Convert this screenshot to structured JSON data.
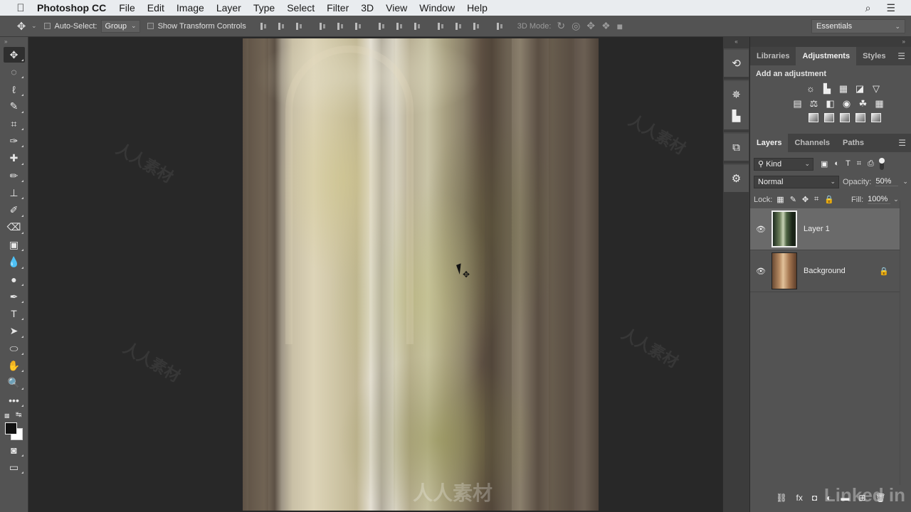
{
  "menubar": {
    "apple_icon": "",
    "app_name": "Photoshop CC",
    "items": [
      "File",
      "Edit",
      "Image",
      "Layer",
      "Type",
      "Select",
      "Filter",
      "3D",
      "View",
      "Window",
      "Help"
    ],
    "search_icon": "⌕",
    "list_icon": "☰"
  },
  "options_bar": {
    "tool_icon": "✥",
    "auto_select_label": "Auto-Select:",
    "auto_select_checked": false,
    "auto_select_target": "Group",
    "show_transform_label": "Show Transform Controls",
    "show_transform_checked": false,
    "mode_3d_label": "3D Mode:",
    "workspace": "Essentials"
  },
  "toolbar": {
    "tools": [
      {
        "name": "move-tool",
        "glyph": "✥",
        "active": true
      },
      {
        "name": "marquee-tool",
        "glyph": "◌"
      },
      {
        "name": "lasso-tool",
        "glyph": "ℓ"
      },
      {
        "name": "quick-selection-tool",
        "glyph": "✎"
      },
      {
        "name": "crop-tool",
        "glyph": "⌗"
      },
      {
        "name": "eyedropper-tool",
        "glyph": "✑"
      },
      {
        "name": "healing-brush-tool",
        "glyph": "✚"
      },
      {
        "name": "brush-tool",
        "glyph": "✏"
      },
      {
        "name": "clone-stamp-tool",
        "glyph": "⊥"
      },
      {
        "name": "history-brush-tool",
        "glyph": "✐"
      },
      {
        "name": "eraser-tool",
        "glyph": "⌫"
      },
      {
        "name": "gradient-tool",
        "glyph": "▣"
      },
      {
        "name": "blur-tool",
        "glyph": "💧"
      },
      {
        "name": "dodge-tool",
        "glyph": "●"
      },
      {
        "name": "pen-tool",
        "glyph": "✒"
      },
      {
        "name": "type-tool",
        "glyph": "T"
      },
      {
        "name": "path-selection-tool",
        "glyph": "➤"
      },
      {
        "name": "ellipse-tool",
        "glyph": "⬭"
      },
      {
        "name": "hand-tool",
        "glyph": "✋"
      },
      {
        "name": "zoom-tool",
        "glyph": "🔍"
      },
      {
        "name": "edit-toolbar",
        "glyph": "•••"
      }
    ],
    "quick_mask_icon": "◙",
    "screen_mode_icon": "▭",
    "foreground_color": "#111111",
    "background_color": "#ffffff"
  },
  "dock": {
    "icons": [
      "history-icon",
      "navigator-icon",
      "histogram-icon",
      "transform-icon",
      "properties-icon"
    ],
    "glyphs": [
      "⟲",
      "✵",
      "▙",
      "⧉",
      "⚙"
    ]
  },
  "adjustments_panel": {
    "tabs": [
      "Libraries",
      "Adjustments",
      "Styles"
    ],
    "active_tab": "Adjustments",
    "title": "Add an adjustment",
    "row1": [
      "brightness-contrast",
      "levels",
      "curves",
      "exposure",
      "gradient"
    ],
    "row1_glyphs": [
      "☼",
      "▙",
      "▦",
      "◪",
      "▽"
    ],
    "row2": [
      "hue-saturation",
      "color-balance",
      "black-white",
      "photo-filter",
      "channel-mixer",
      "color-lookup"
    ],
    "row2_glyphs": [
      "▤",
      "⚖",
      "◧",
      "◉",
      "☘",
      "▦"
    ],
    "row3": [
      "invert",
      "posterize",
      "threshold",
      "selective-color",
      "gradient-map"
    ]
  },
  "layers_panel": {
    "tabs": [
      "Layers",
      "Channels",
      "Paths"
    ],
    "active_tab": "Layers",
    "filter_kind": "Kind",
    "filter_icons": [
      "▣",
      "◐",
      "T",
      "⌗",
      "⎙"
    ],
    "blend_mode": "Normal",
    "opacity_label": "Opacity:",
    "opacity_value": "50%",
    "lock_label": "Lock:",
    "lock_icons": [
      "▦",
      "✎",
      "✥",
      "⌗",
      "🔒"
    ],
    "fill_label": "Fill:",
    "fill_value": "100%",
    "layers": [
      {
        "name": "Layer 1",
        "visible": true,
        "selected": true,
        "locked": false
      },
      {
        "name": "Background",
        "visible": true,
        "selected": false,
        "locked": true
      }
    ],
    "footer_icons": [
      "⛓",
      "fx",
      "◘",
      "◐",
      "▬",
      "⊞",
      "🗑"
    ]
  },
  "watermark": {
    "text": "人人素材",
    "brand": "Linked in"
  }
}
